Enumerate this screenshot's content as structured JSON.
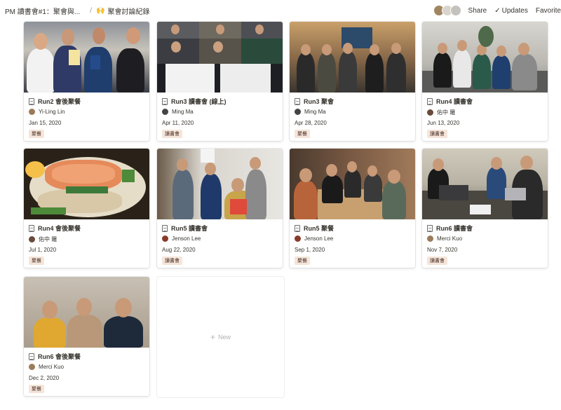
{
  "breadcrumb": {
    "parent": "PM 讀書會#1：聚會與...",
    "separator": "/",
    "current_icon": "🙌",
    "current": "聚會討論紀錄"
  },
  "topbar": {
    "share": "Share",
    "updates": "Updates",
    "favorite": "Favorite"
  },
  "new_label": "New",
  "tag_colors": {
    "聚餐": "#f5e5da",
    "讀書會": "#f5e5da"
  },
  "cards": [
    {
      "title": "Run2 會後聚餐",
      "person": "Yi-Ling Lin",
      "date": "Jan 15, 2020",
      "tag": "聚餐"
    },
    {
      "title": "Run3 讀書會 (線上)",
      "person": "Ming Ma",
      "date": "Apr 11, 2020",
      "tag": "讀書會"
    },
    {
      "title": "Run3 聚會",
      "person": "Ming Ma",
      "date": "Apr 28, 2020",
      "tag": "聚餐"
    },
    {
      "title": "Run4 讀書會",
      "person": "佑中 羅",
      "date": "Jun 13, 2020",
      "tag": "讀書會"
    },
    {
      "title": "Run4 會後聚餐",
      "person": "佑中 羅",
      "date": "Jul 1, 2020",
      "tag": "聚餐"
    },
    {
      "title": "Run5 讀書會",
      "person": "Jenson Lee",
      "date": "Aug 22, 2020",
      "tag": "讀書會"
    },
    {
      "title": "Run5 聚餐",
      "person": "Jenson Lee",
      "date": "Sep 1, 2020",
      "tag": "聚餐"
    },
    {
      "title": "Run6 讀書會",
      "person": "Merci Kuo",
      "date": "Nov 7, 2020",
      "tag": "讀書會"
    },
    {
      "title": "Run6 會後聚餐",
      "person": "Merci Kuo",
      "date": "Dec 2, 2020",
      "tag": "聚餐"
    }
  ]
}
